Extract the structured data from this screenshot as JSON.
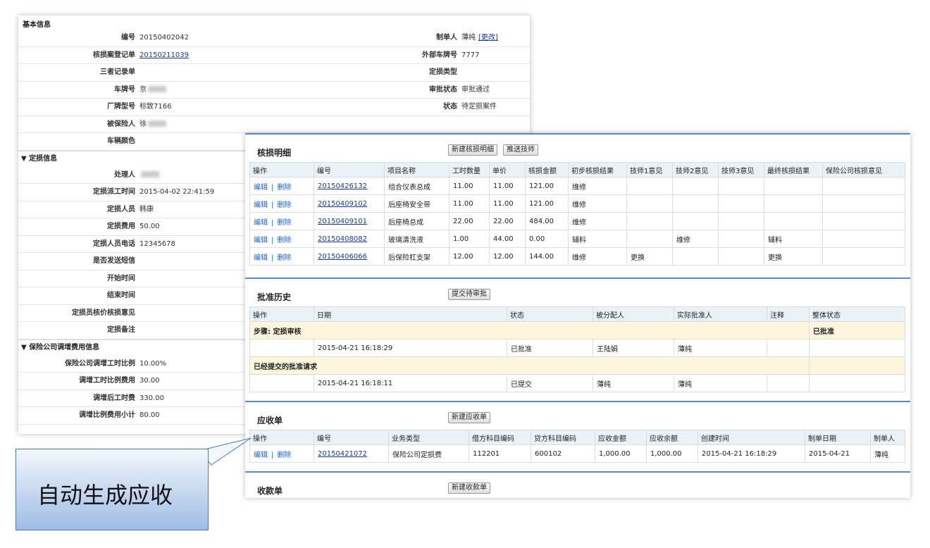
{
  "basic": {
    "title": "基本信息",
    "rows": [
      {
        "l": "编号",
        "v": "20150402042",
        "l2": "制单人",
        "v2": "薄纯",
        "v2_link": "[更改]"
      },
      {
        "l": "核损案登记单",
        "v": "20150211039",
        "link": true,
        "l2": "外部车牌号",
        "v2": "7777"
      },
      {
        "l": "三者记录单",
        "v": "",
        "l2": "定损类型",
        "v2": ""
      },
      {
        "l": "车牌号",
        "v": "京",
        "blur": true,
        "l2": "审批状态",
        "v2": "审批通过"
      },
      {
        "l": "厂牌型号",
        "v": "标致7166",
        "l2": "状态",
        "v2": "待定损案件"
      },
      {
        "l": "被保险人",
        "v": "徐",
        "blur": true
      },
      {
        "l": "车辆颜色",
        "v": ""
      }
    ]
  },
  "dingsun": {
    "title": "▼ 定损信息",
    "rows": [
      {
        "l": "处理人",
        "v": "",
        "blur": true
      },
      {
        "l": "定损派工时间",
        "v": "2015-04-02 22:41:59"
      },
      {
        "l": "定损人员",
        "v": "韩康"
      },
      {
        "l": "定损费用",
        "v": "50.00"
      },
      {
        "l": "定损人员电话",
        "v": "12345678"
      },
      {
        "l": "是否发送短信",
        "v": ""
      },
      {
        "l": "开始时间",
        "v": ""
      },
      {
        "l": "结束时间",
        "v": ""
      },
      {
        "l": "定损员核价核损意见",
        "v": ""
      },
      {
        "l": "定损备注",
        "v": ""
      }
    ]
  },
  "insurance": {
    "title": "▼ 保险公司调增费用信息",
    "rows": [
      {
        "l": "保险公司调增工时比例",
        "v": "10.00%"
      },
      {
        "l": "调增工时比例费用",
        "v": "30.00"
      },
      {
        "l": "调增后工时费",
        "v": "330.00"
      },
      {
        "l": "调增比例费用小计",
        "v": "80.00"
      }
    ]
  },
  "hesun": {
    "title": "核损明细",
    "buttons": [
      "新建核损明细",
      "推送技师"
    ],
    "headers": [
      "操作",
      "编号",
      "项目名称",
      "工时数量",
      "单价",
      "核损金额",
      "初步核损结果",
      "技师1意见",
      "技师2意见",
      "技师3意见",
      "最终核损结果",
      "保险公司核损意见"
    ],
    "edit": "编辑",
    "sep": "|",
    "del": "删除",
    "rows": [
      [
        "20150426132",
        "组合仪表总成",
        "11.00",
        "11.00",
        "121.00",
        "维修",
        "",
        "",
        "",
        "",
        ""
      ],
      [
        "20150409102",
        "后座椅安全带",
        "11.00",
        "11.00",
        "121.00",
        "维修",
        "",
        "",
        "",
        "",
        ""
      ],
      [
        "20150409101",
        "后座椅总成",
        "22.00",
        "22.00",
        "484.00",
        "维修",
        "",
        "",
        "",
        "",
        ""
      ],
      [
        "20150408082",
        "玻璃清洗液",
        "1.00",
        "44.00",
        "0.00",
        "辅料",
        "",
        "维修",
        "",
        "辅料",
        ""
      ],
      [
        "20150406066",
        "后保险杠支架",
        "12.00",
        "12.00",
        "144.00",
        "维修",
        "更换",
        "",
        "",
        "更换",
        ""
      ]
    ]
  },
  "pizhun": {
    "title": "批准历史",
    "button": "提交待审批",
    "headers": [
      "操作",
      "日期",
      "状态",
      "被分配人",
      "实际批准人",
      "注释",
      "整体状态"
    ],
    "step1": {
      "label": "步骤: 定损审核",
      "status": "已批准"
    },
    "row1": [
      "2015-04-21 16:18:29",
      "已批准",
      "王陆娟",
      "薄纯"
    ],
    "step2": {
      "label": "已经提交的批准请求"
    },
    "row2": [
      "2015-04-21 16:18:11",
      "已提交",
      "薄纯",
      "薄纯"
    ]
  },
  "yingshou": {
    "title": "应收单",
    "button": "新建应收单",
    "headers": [
      "操作",
      "编号",
      "业务类型",
      "借方科目编码",
      "贷方科目编码",
      "应收金额",
      "应收余额",
      "创建时间",
      "制单日期",
      "制单人"
    ],
    "row": [
      "20150421072",
      "保险公司定损费",
      "112201",
      "600102",
      "1,000.00",
      "1,000.00",
      "2015-04-21 16:18:29",
      "2015-04-21",
      "薄纯"
    ]
  },
  "shoukuan": {
    "title": "收款单",
    "button": "新建收款单"
  },
  "callout": {
    "text": "自动生成应收"
  }
}
